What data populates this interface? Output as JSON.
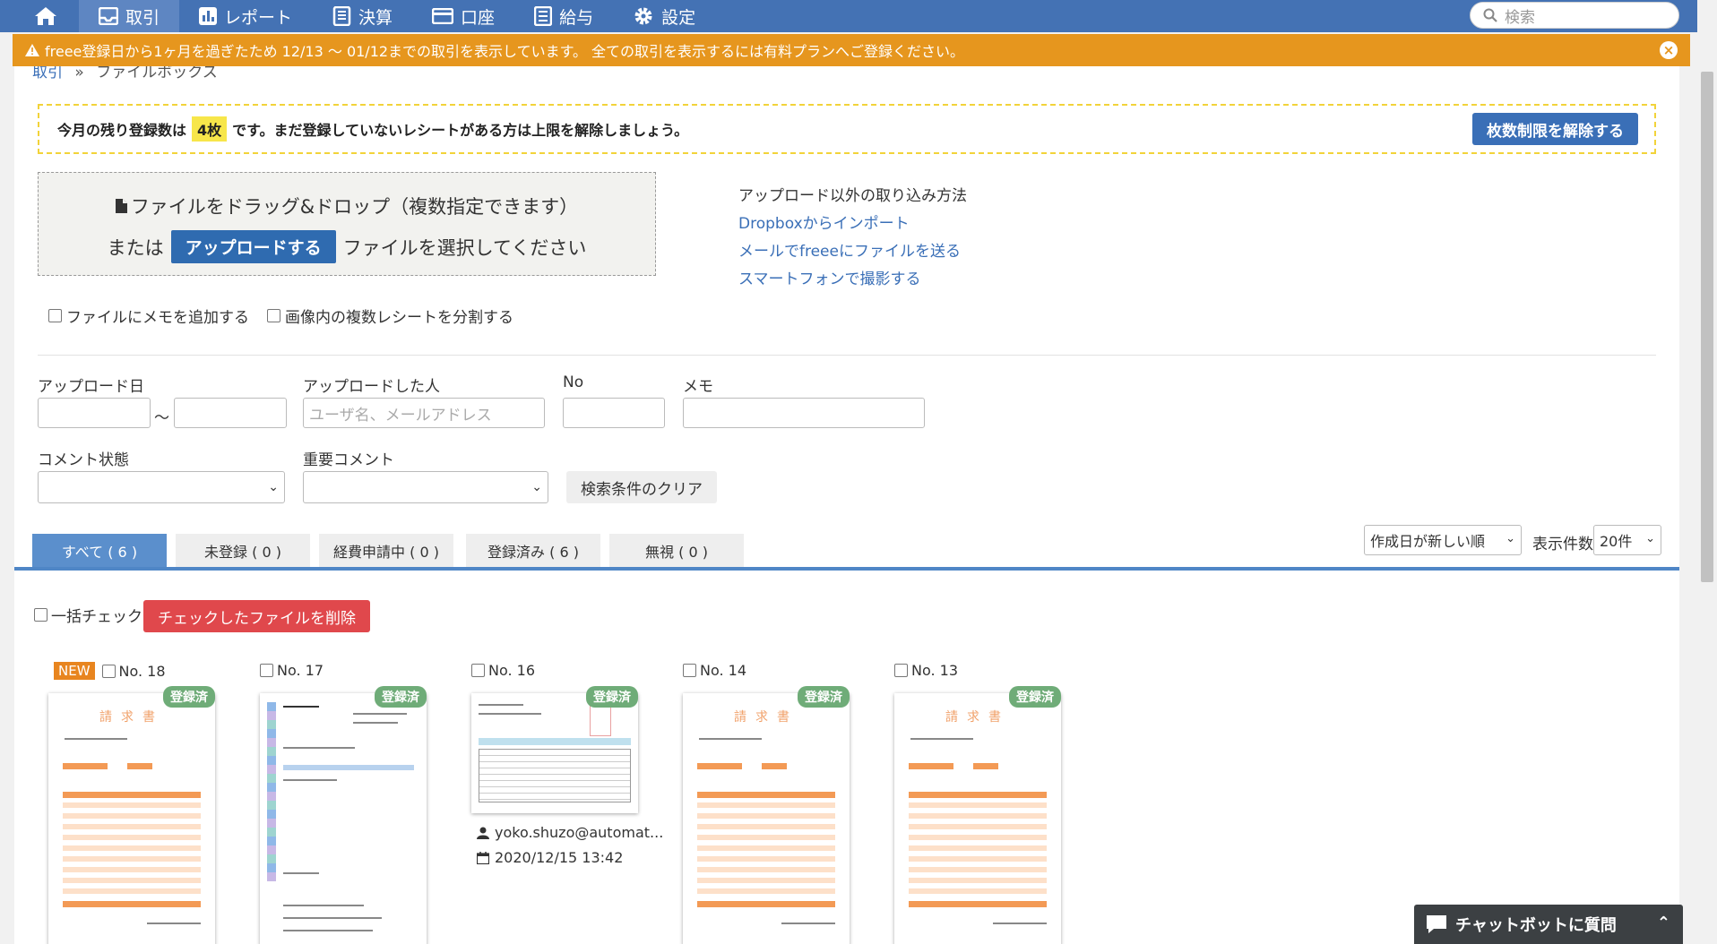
{
  "nav": {
    "items": [
      {
        "label": "取引",
        "icon": "inbox-icon",
        "active": true
      },
      {
        "label": "レポート",
        "icon": "bar-chart-icon",
        "active": false
      },
      {
        "label": "決算",
        "icon": "book-icon",
        "active": false
      },
      {
        "label": "口座",
        "icon": "credit-card-icon",
        "active": false
      },
      {
        "label": "給与",
        "icon": "list-icon",
        "active": false
      },
      {
        "label": "設定",
        "icon": "gear-icon",
        "active": false
      }
    ],
    "search_placeholder": "検索"
  },
  "warning": {
    "text": "freee登録日から1ヶ月を過ぎたため 12/13 ～ 01/12までの取引を表示しています。 全ての取引を表示するには有料プランへご登録ください。"
  },
  "breadcrumb": {
    "parent": "取引",
    "sep": "»",
    "current": "ファイルボックス"
  },
  "limit": {
    "prefix": "今月の残り登録数は",
    "count": "4枚",
    "suffix": "です。まだ登録していないレシートがある方は上限を解除しましょう。",
    "button": "枚数制限を解除する"
  },
  "upload": {
    "drop_text": "ファイルをドラッグ&ドロップ（複数指定できます）",
    "or": "または",
    "button": "アップロードする",
    "select_text": "ファイルを選択してください"
  },
  "other_methods": {
    "title": "アップロード以外の取り込み方法",
    "links": [
      "Dropboxからインポート",
      "メールでfreeeにファイルを送る",
      "スマートフォンで撮影する"
    ]
  },
  "options": {
    "add_memo": "ファイルにメモを追加する",
    "split_receipts": "画像内の複数レシートを分割する"
  },
  "filters": {
    "upload_date": "アップロード日",
    "tilde": "～",
    "uploader": "アップロードした人",
    "uploader_placeholder": "ユーザ名、メールアドレス",
    "no": "No",
    "memo": "メモ",
    "comment_status": "コメント状態",
    "important_comment": "重要コメント",
    "clear": "検索条件のクリア"
  },
  "tabs": [
    "すべて ( 6 )",
    "未登録 ( 0 )",
    "経費申請中 ( 0 )",
    "登録済み ( 6 )",
    "無視 ( 0 )"
  ],
  "sort": {
    "value": "作成日が新しい順",
    "per_page_label": "表示件数",
    "per_page": "20件"
  },
  "bulk": {
    "check_all": "一括チェック",
    "delete": "チェックしたファイルを削除"
  },
  "files": [
    {
      "no": "No. 18",
      "new": "NEW",
      "status": "登録済",
      "doc_title": "請求書"
    },
    {
      "no": "No. 17",
      "status": "登録済"
    },
    {
      "no": "No. 16",
      "status": "登録済",
      "user": "yoko.shuzo@automat...",
      "date": "2020/12/15 13:42"
    },
    {
      "no": "No. 14",
      "status": "登録済",
      "doc_title": "請求書"
    },
    {
      "no": "No. 13",
      "status": "登録済",
      "doc_title": "請求書"
    }
  ],
  "chat": {
    "label": "チャットボットに質問"
  },
  "colors": {
    "nav": "#4472b4",
    "warning": "#e6961e",
    "primary": "#3a6fb7",
    "danger": "#e0484c",
    "registered": "#6fac78"
  }
}
